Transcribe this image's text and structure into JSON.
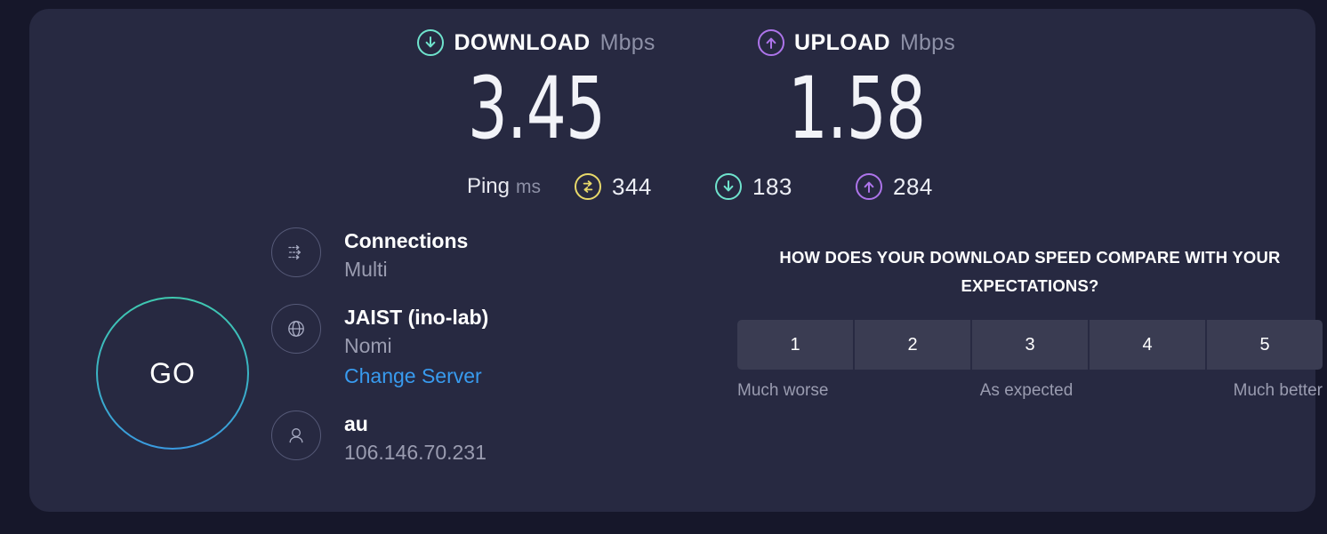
{
  "theme": {
    "page_bg": "#16172a",
    "panel_bg": "#272941",
    "download_accent": "#6fe3cd",
    "upload_accent": "#ad74ea",
    "idle_accent": "#e8d96a",
    "link_accent": "#389bef",
    "go_gradient_top": "#3fc9b0",
    "go_gradient_bottom": "#3a9ae0"
  },
  "results": {
    "download": {
      "icon": "download-arrow-icon",
      "label": "DOWNLOAD",
      "unit": "Mbps",
      "value": "3.45"
    },
    "upload": {
      "icon": "upload-arrow-icon",
      "label": "UPLOAD",
      "unit": "Mbps",
      "value": "1.58"
    }
  },
  "ping": {
    "label": "Ping",
    "unit": "ms",
    "metrics": [
      {
        "icon": "idle-latency-icon",
        "name": "idle",
        "value": "344"
      },
      {
        "icon": "download-arrow-icon",
        "name": "download-latency",
        "value": "183"
      },
      {
        "icon": "upload-arrow-icon",
        "name": "upload-latency",
        "value": "284"
      }
    ]
  },
  "go_button": {
    "label": "GO"
  },
  "info": {
    "connections": {
      "icon": "multi-connections-icon",
      "title": "Connections",
      "subtitle": "Multi"
    },
    "server": {
      "icon": "globe-icon",
      "title": "JAIST (ino-lab)",
      "subtitle": "Nomi",
      "link": "Change Server"
    },
    "client": {
      "icon": "person-icon",
      "title": "au",
      "subtitle": "106.146.70.231"
    }
  },
  "rating": {
    "question": "HOW DOES YOUR DOWNLOAD SPEED COMPARE WITH YOUR EXPECTATIONS?",
    "options": [
      "1",
      "2",
      "3",
      "4",
      "5"
    ],
    "legend": {
      "low": "Much worse",
      "mid": "As expected",
      "high": "Much better"
    }
  }
}
